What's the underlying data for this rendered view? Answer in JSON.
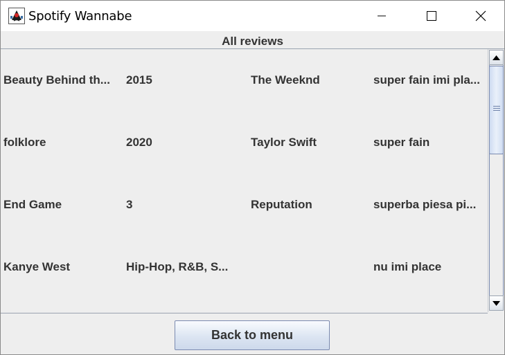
{
  "window": {
    "title": "Spotify Wannabe",
    "app_icon": "java-duke-icon",
    "controls": [
      "minimize-icon",
      "maximize-icon",
      "close-icon"
    ]
  },
  "header": {
    "label": "All reviews"
  },
  "table": {
    "rows": [
      [
        "Beauty Behind th...",
        "2015",
        "The Weeknd",
        "super fain imi pla..."
      ],
      [
        "folklore",
        "2020",
        "Taylor Swift",
        "super fain"
      ],
      [
        "End Game",
        "3",
        "Reputation",
        "superba piesa pi..."
      ],
      [
        "Kanye West",
        "Hip-Hop, R&B, S...",
        "",
        "nu imi place"
      ]
    ]
  },
  "scrollbar": {
    "up_icon": "arrow-up-icon",
    "down_icon": "arrow-down-icon"
  },
  "footer": {
    "back_label": "Back to menu"
  },
  "colors": {
    "window_bg": "#eeeeee",
    "titlebar_bg": "#ffffff",
    "text": "#333333",
    "button_border": "#7a8ab0"
  }
}
